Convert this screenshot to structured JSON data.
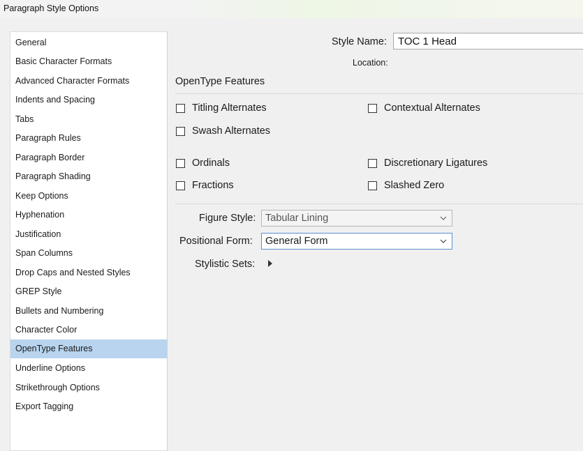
{
  "window": {
    "title": "Paragraph Style Options"
  },
  "sidebar": {
    "items": [
      {
        "label": "General"
      },
      {
        "label": "Basic Character Formats"
      },
      {
        "label": "Advanced Character Formats"
      },
      {
        "label": "Indents and Spacing"
      },
      {
        "label": "Tabs"
      },
      {
        "label": "Paragraph Rules"
      },
      {
        "label": "Paragraph Border"
      },
      {
        "label": "Paragraph Shading"
      },
      {
        "label": "Keep Options"
      },
      {
        "label": "Hyphenation"
      },
      {
        "label": "Justification"
      },
      {
        "label": "Span Columns"
      },
      {
        "label": "Drop Caps and Nested Styles"
      },
      {
        "label": "GREP Style"
      },
      {
        "label": "Bullets and Numbering"
      },
      {
        "label": "Character Color"
      },
      {
        "label": "OpenType Features"
      },
      {
        "label": "Underline Options"
      },
      {
        "label": "Strikethrough Options"
      },
      {
        "label": "Export Tagging"
      }
    ],
    "selected": "OpenType Features"
  },
  "header": {
    "style_name_label": "Style Name:",
    "style_name_value": "TOC 1 Head",
    "location_label": "Location:"
  },
  "section": {
    "title": "OpenType Features"
  },
  "checkboxes": {
    "titling_alternates": {
      "label": "Titling Alternates",
      "checked": false
    },
    "contextual_alternates": {
      "label": "Contextual Alternates",
      "checked": false
    },
    "swash_alternates": {
      "label": "Swash Alternates",
      "checked": false
    },
    "ordinals": {
      "label": "Ordinals",
      "checked": false
    },
    "discretionary_ligatures": {
      "label": "Discretionary Ligatures",
      "checked": false
    },
    "fractions": {
      "label": "Fractions",
      "checked": false
    },
    "slashed_zero": {
      "label": "Slashed Zero",
      "checked": false
    }
  },
  "figure_style": {
    "label": "Figure Style:",
    "value": "Tabular Lining"
  },
  "positional_form": {
    "label": "Positional Form:",
    "value": "General Form"
  },
  "stylistic_sets": {
    "label": "Stylistic Sets:"
  },
  "colors": {
    "selected_item": "#b8d4ee",
    "focus_border": "#5a8ed0"
  }
}
